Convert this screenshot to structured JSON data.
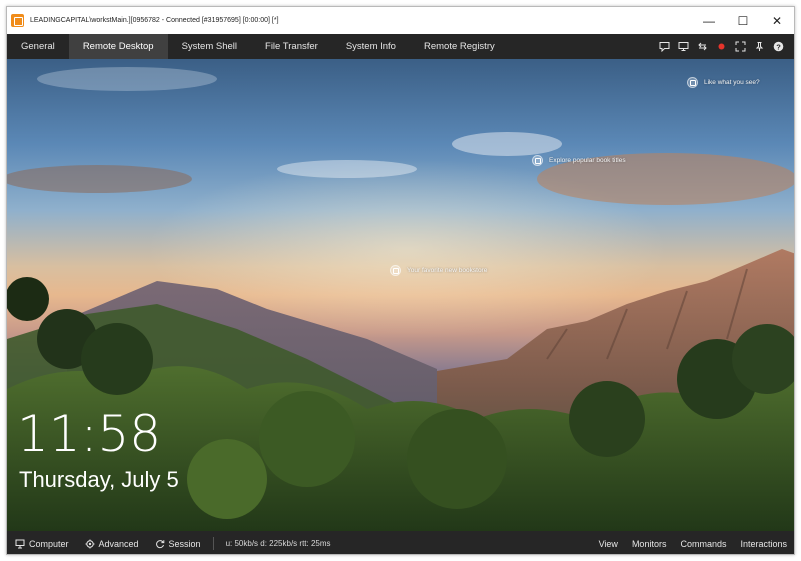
{
  "window": {
    "title": "LEADINGCAPITAL\\workstMain.][0956782 - Connected [#31957695] [0:00:00] [*]",
    "controls": {
      "minimize": "—",
      "maximize": "☐",
      "close": "✕"
    }
  },
  "tabs": [
    {
      "label": "General",
      "active": false
    },
    {
      "label": "Remote Desktop",
      "active": true
    },
    {
      "label": "System Shell",
      "active": false
    },
    {
      "label": "File Transfer",
      "active": false
    },
    {
      "label": "System Info",
      "active": false
    },
    {
      "label": "Remote Registry",
      "active": false
    }
  ],
  "toolbar_icons": [
    "chat-icon",
    "display-icon",
    "swap-icon",
    "record-icon",
    "fit-icon",
    "pin-icon",
    "help-icon"
  ],
  "remote_screen": {
    "hotspots": [
      {
        "text": "Like what you see?"
      },
      {
        "text": "Explore popular book titles"
      },
      {
        "text": "Your favorite new bookstore"
      }
    ],
    "time": "11:58",
    "date": "Thursday, July 5"
  },
  "statusbar": {
    "left": [
      {
        "label": "Computer",
        "icon": "computer-icon"
      },
      {
        "label": "Advanced",
        "icon": "gear-icon"
      },
      {
        "label": "Session",
        "icon": "session-icon"
      }
    ],
    "stats": "u: 50kb/s d: 225kb/s rtt: 25ms",
    "right": [
      "View",
      "Monitors",
      "Commands",
      "Interactions"
    ]
  },
  "colors": {
    "bar_bg": "#262626",
    "active_tab": "#404040",
    "app_icon": "#f08c1a",
    "record": "#e5342b"
  }
}
